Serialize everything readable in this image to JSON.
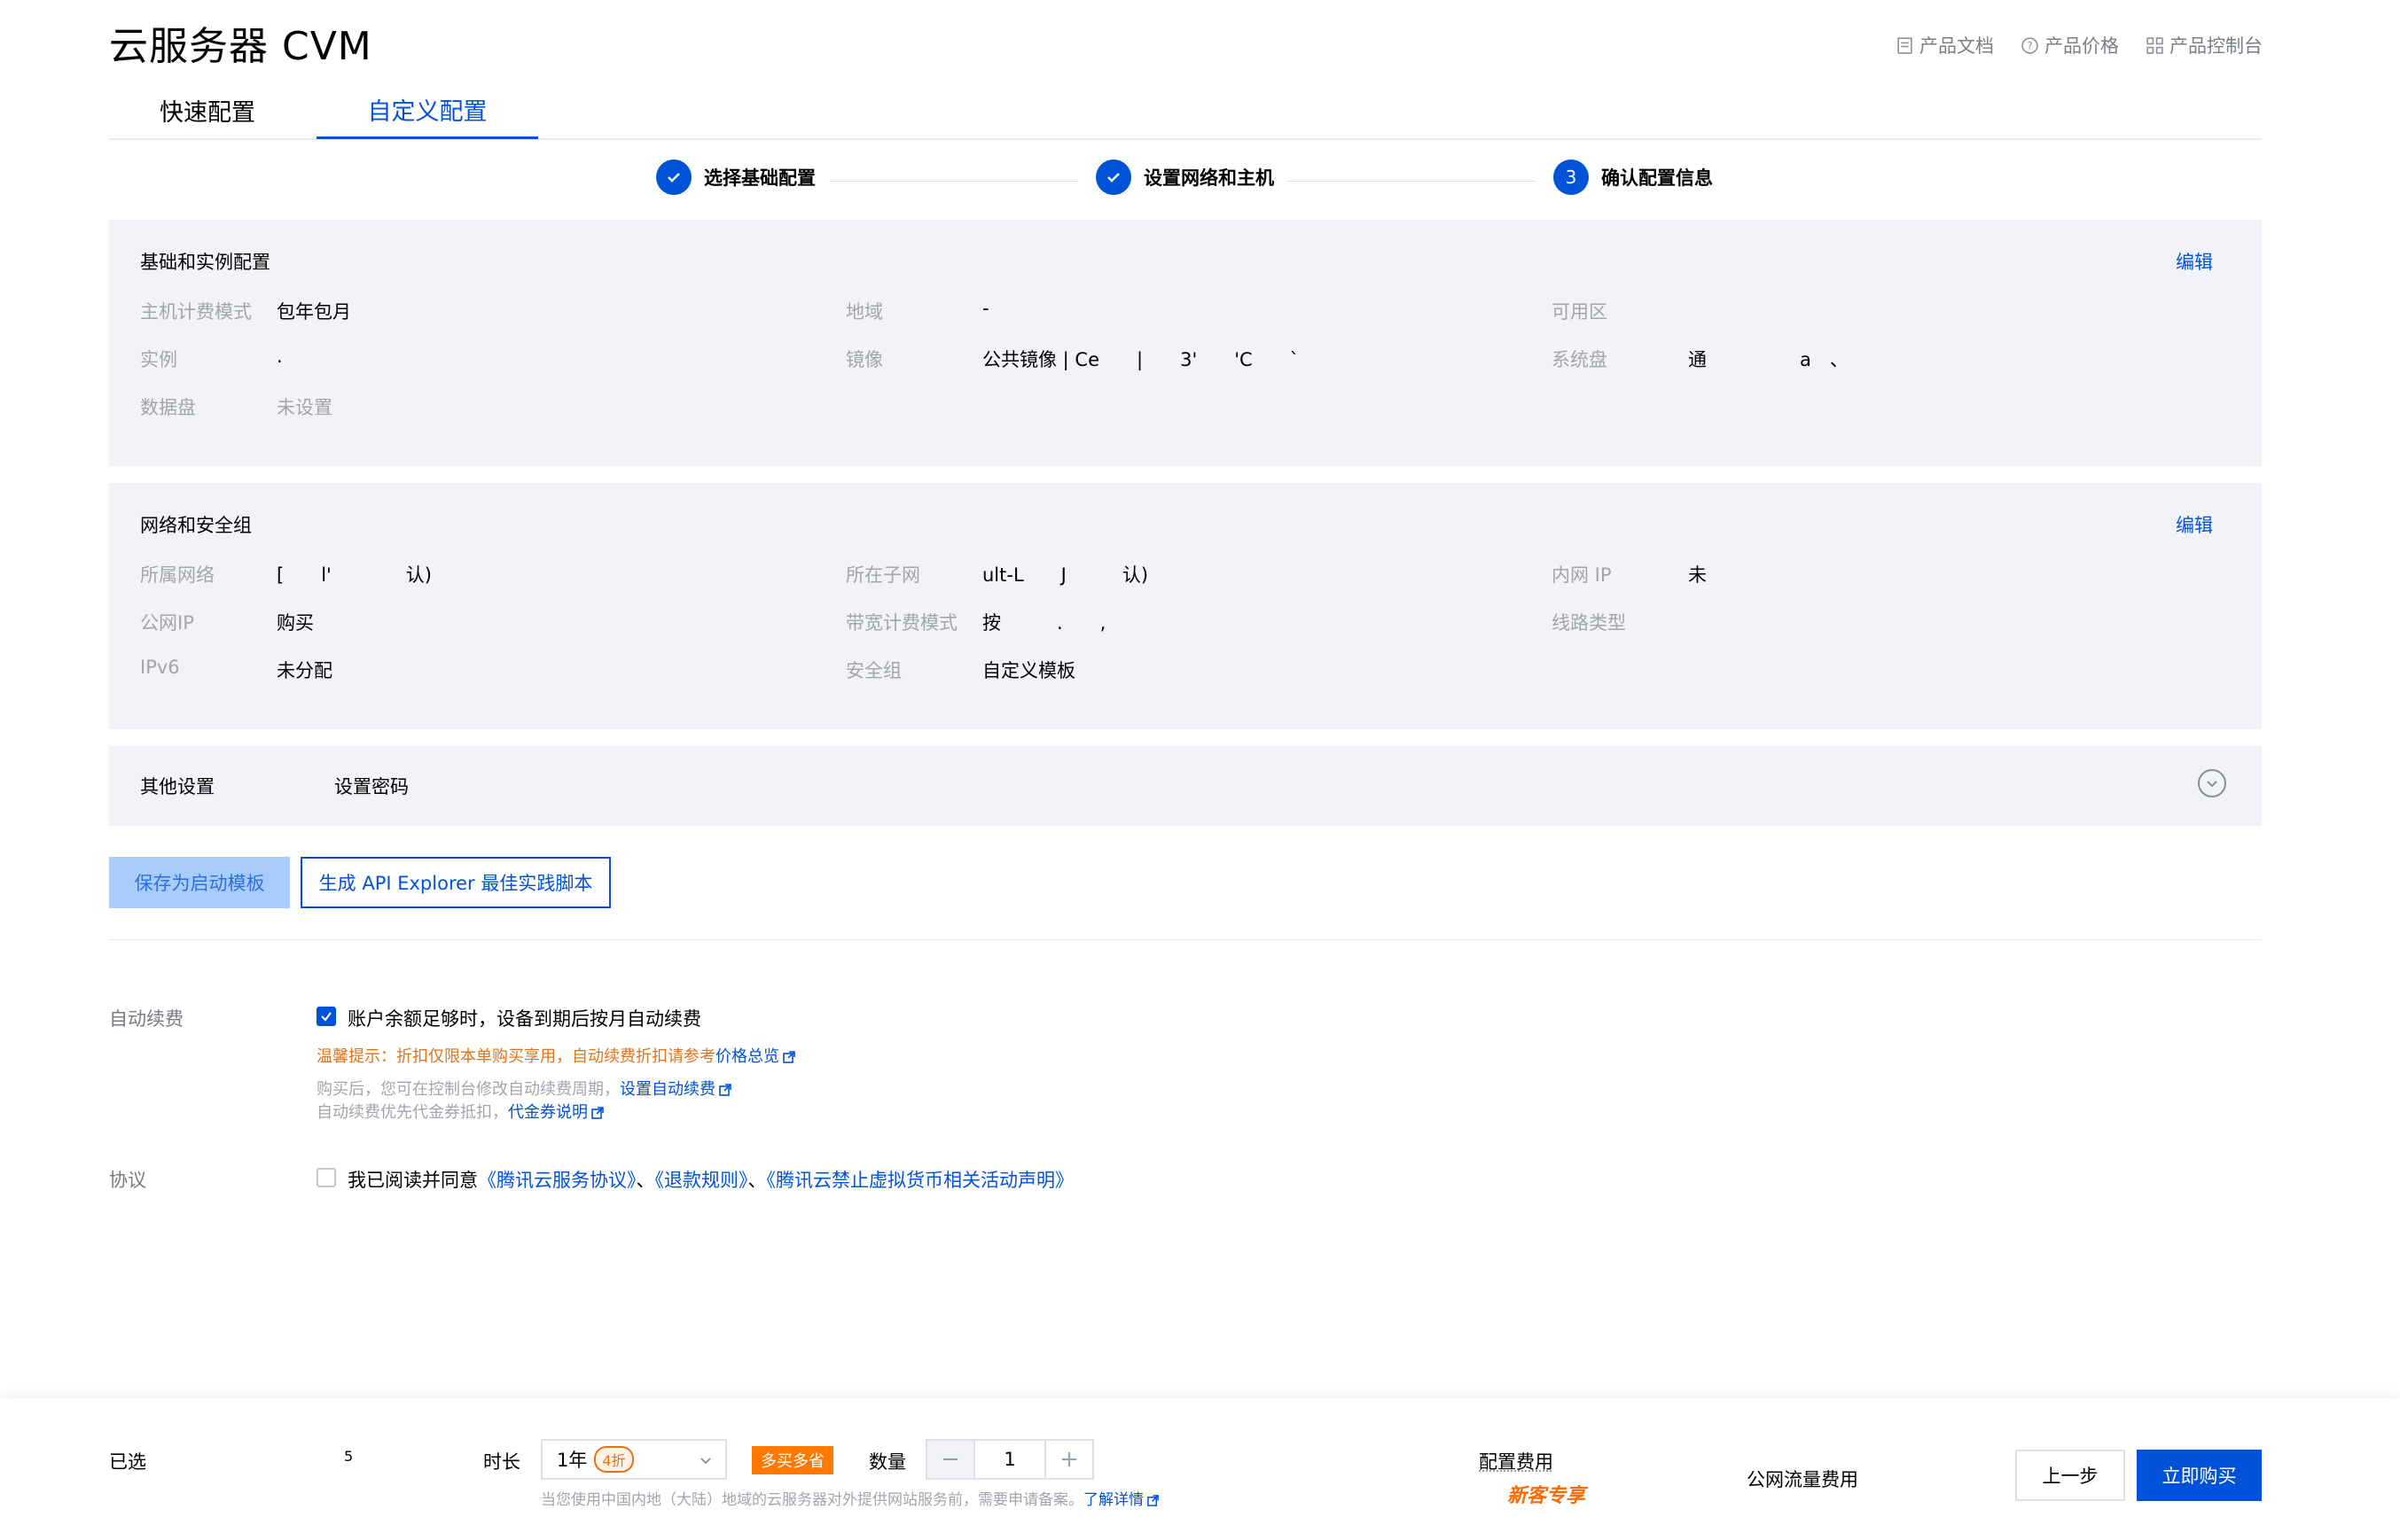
{
  "header": {
    "title": "云服务器 CVM",
    "links": [
      {
        "label": "产品文档",
        "icon": "document-icon"
      },
      {
        "label": "产品价格",
        "icon": "question-circle-icon"
      },
      {
        "label": "产品控制台",
        "icon": "grid-icon"
      }
    ]
  },
  "tabs": {
    "quick": "快速配置",
    "custom": "自定义配置",
    "active": "custom"
  },
  "steps": [
    {
      "label": "选择基础配置",
      "state": "done"
    },
    {
      "label": "设置网络和主机",
      "state": "done"
    },
    {
      "label": "确认配置信息",
      "state": "current",
      "number": "3"
    }
  ],
  "basic": {
    "title": "基础和实例配置",
    "edit": "编辑",
    "billing_mode_label": "主机计费模式",
    "billing_mode_value": "包年包月",
    "region_label": "地域",
    "region_value": "-",
    "zone_label": "可用区",
    "zone_value": "",
    "instance_label": "实例",
    "instance_value": ".",
    "image_label": "镜像",
    "image_value": "公共镜像 | Ce　　|　　3'　　'C　　`",
    "system_disk_label": "系统盘",
    "system_disk_value": "通　　　　　a　、",
    "data_disk_label": "数据盘",
    "data_disk_value": "未设置"
  },
  "network": {
    "title": "网络和安全组",
    "edit": "编辑",
    "vpc_label": "所属网络",
    "vpc_value": "[　　l'　　　　认)",
    "subnet_label": "所在子网",
    "subnet_value": "ult-L　　J　　　认)",
    "private_ip_label": "内网 IP",
    "private_ip_value": "未",
    "public_ip_label": "公网IP",
    "public_ip_value": "购买",
    "bandwidth_label": "带宽计费模式",
    "bandwidth_value": "按　　　.　　,",
    "line_label": "线路类型",
    "line_value": "",
    "ipv6_label": "IPv6",
    "ipv6_value": "未分配",
    "sg_label": "安全组",
    "sg_value": "自定义模板"
  },
  "other": {
    "label": "其他设置",
    "value": "设置密码"
  },
  "actions": {
    "save_template": "保存为启动模板",
    "api_explorer": "生成 API Explorer 最佳实践脚本"
  },
  "renew": {
    "label": "自动续费",
    "checkbox_label": "账户余额足够时，设备到期后按月自动续费",
    "checked": true,
    "warning": "温馨提示：折扣仅限本单购买享用，自动续费折扣请参考",
    "warning_link": "价格总览",
    "hint1": "购买后，您可在控制台修改自动续费周期，",
    "hint1_link": "设置自动续费",
    "hint2": "自动续费优先代金券抵扣，",
    "hint2_link": "代金券说明"
  },
  "agreement": {
    "label": "协议",
    "prefix": "我已阅读并同意",
    "link1": "《腾讯云服务协议》",
    "sep1": "、",
    "link2": "《退款规则》",
    "sep2": "、",
    "link3": "《腾讯云禁止虚拟货币相关活动声明》",
    "checked": false
  },
  "footer": {
    "selected_label": "已选",
    "selected_value": "5",
    "duration_label": "时长",
    "duration_value": "1年",
    "duration_discount": "4折",
    "promo": "多买多省",
    "quantity_label": "数量",
    "quantity_value": "1",
    "notice": "当您使用中国内地（大陆）地域的云服务器对外提供网站服务前，需要申请备案。",
    "notice_link": "了解详情",
    "config_fee_label": "配置费用",
    "new_customer": "新客专享",
    "traffic_fee_label": "公网流量费用",
    "prev": "上一步",
    "buy": "立即购买"
  },
  "colors": {
    "primary": "#0052d9",
    "warning": "#e37318",
    "panel_bg": "#f2f3f8"
  }
}
